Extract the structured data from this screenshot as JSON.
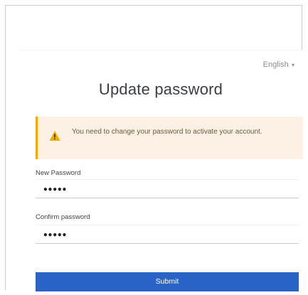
{
  "header": {
    "language": "English",
    "title": "Update password"
  },
  "alert": {
    "icon": "warning-icon",
    "message": "You need to change your password to activate your account.",
    "accent_color": "#f0ab00"
  },
  "form": {
    "new_password": {
      "label": "New Password",
      "value": "•••••"
    },
    "confirm_password": {
      "label": "Confirm password",
      "value": "•••••"
    },
    "submit_label": "Submit",
    "submit_color": "#2a63c6"
  }
}
